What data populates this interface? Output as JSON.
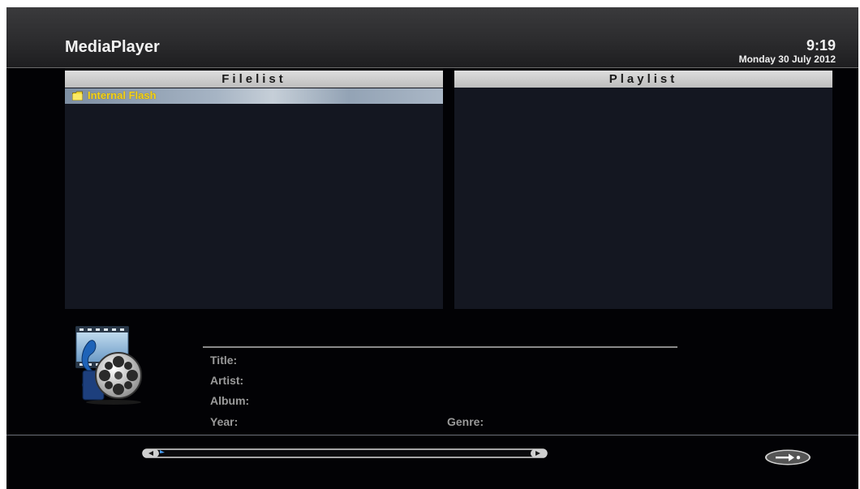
{
  "header": {
    "app_title": "MediaPlayer",
    "time": "9:19",
    "date": "Monday 30 July 2012"
  },
  "filelist": {
    "title": "Filelist",
    "items": [
      {
        "label": "Internal Flash",
        "icon": "folder-icon",
        "selected": true
      }
    ]
  },
  "playlist": {
    "title": "Playlist",
    "items": []
  },
  "info": {
    "title_label": "Title:",
    "artist_label": "Artist:",
    "album_label": "Album:",
    "year_label": "Year:",
    "genre_label": "Genre:"
  },
  "footer": {
    "progress_fraction": 0.0,
    "next_icon": "arrow-right-icon"
  },
  "colors": {
    "background": "#020205",
    "panel": "#141721",
    "panel_header": "#cfcfcf",
    "selection_text": "#f5d21a",
    "label_text": "#9a9a9a"
  }
}
